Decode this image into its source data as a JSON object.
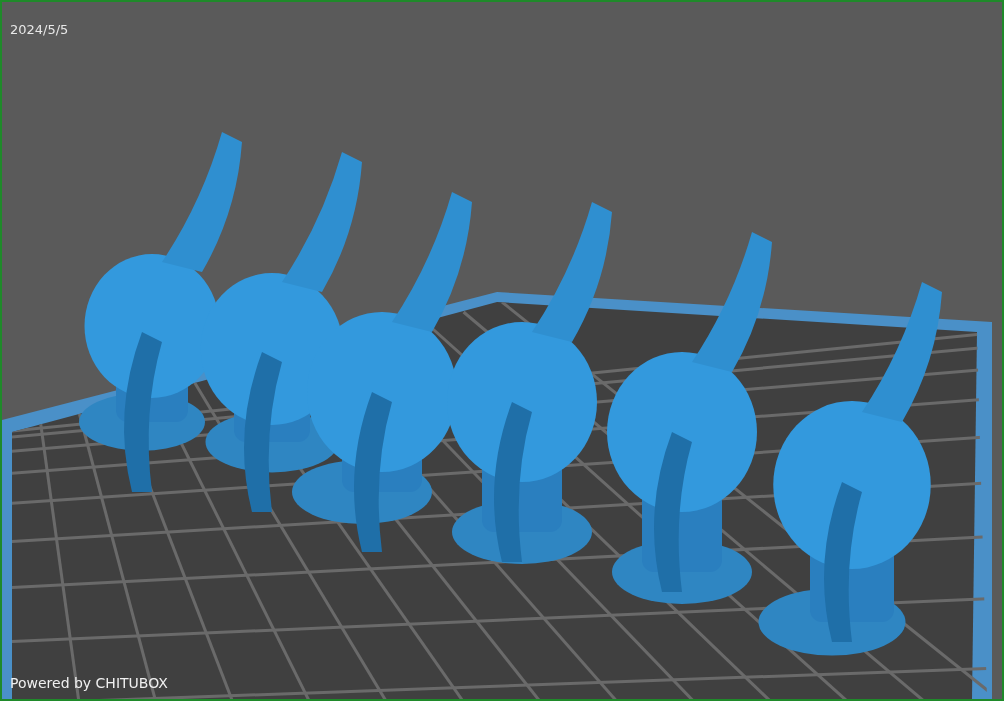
{
  "viewport": {
    "date": "2024/5/5",
    "footer": "Powered by CHITUBOX"
  }
}
